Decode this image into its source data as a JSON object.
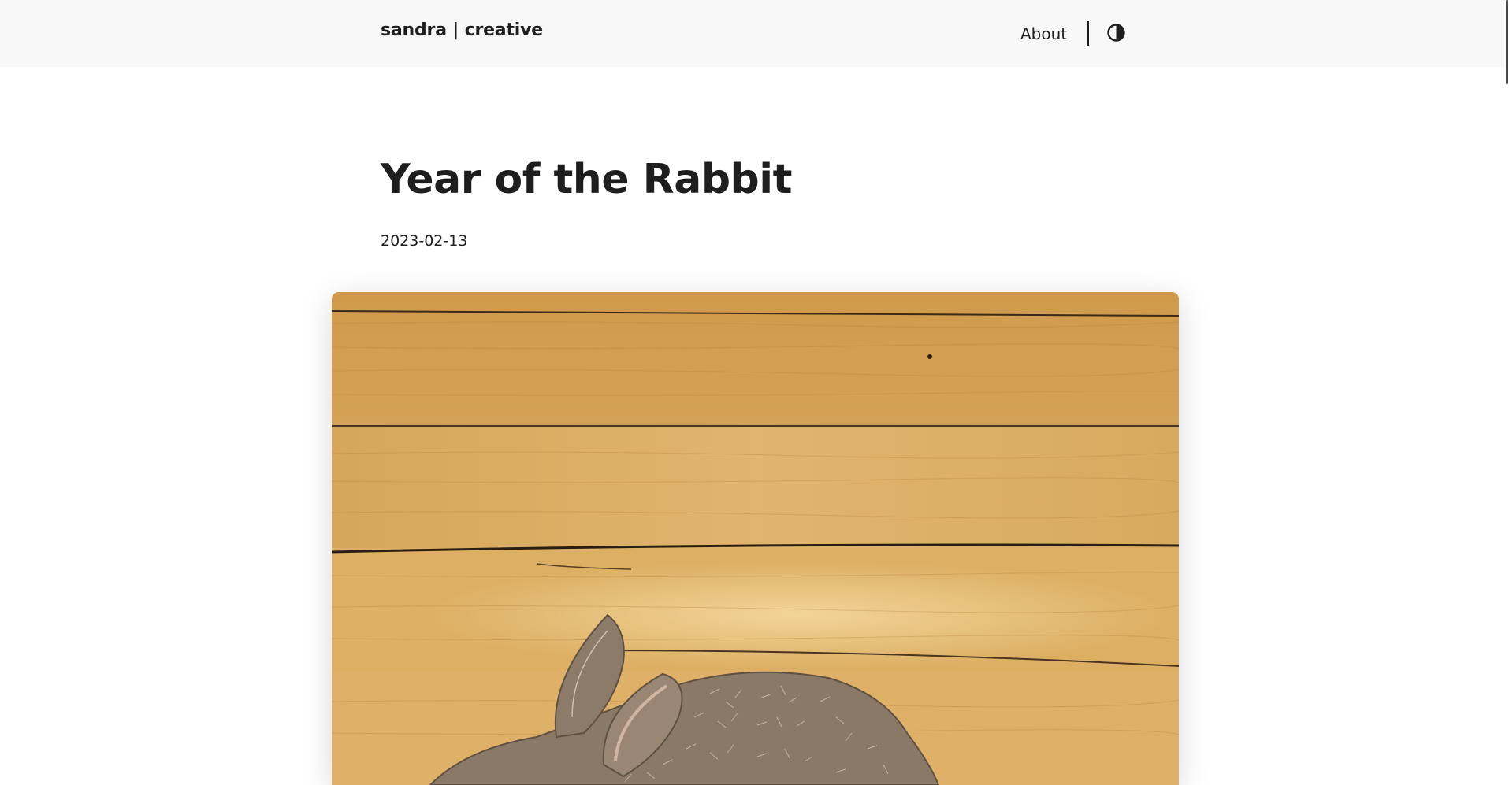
{
  "header": {
    "logo": "sandra | creative",
    "nav": {
      "about_label": "About"
    },
    "theme_toggle_icon": "contrast-icon"
  },
  "post": {
    "title": "Year of the Rabbit",
    "date": "2023-02-13",
    "image_icon": "artwork-photo"
  },
  "colors": {
    "header_bg": "#f8f8f8",
    "text": "#1e1e1e",
    "wood": "#d9a55a",
    "rabbit": "#8b7a66"
  }
}
